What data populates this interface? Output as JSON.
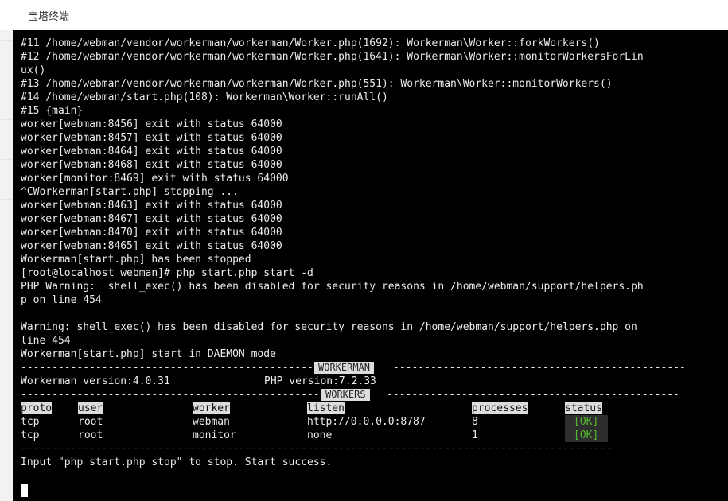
{
  "window": {
    "title": "宝塔终端"
  },
  "colors": {
    "terminal_bg": "#000000",
    "terminal_text": "#ececec",
    "ok_status": "#55b82e",
    "table_header_bg": "#dcdcdc"
  },
  "terminal": {
    "log_lines": [
      "#11 /home/webman/vendor/workerman/workerman/Worker.php(1692): Workerman\\Worker::forkWorkers()",
      "#12 /home/webman/vendor/workerman/workerman/Worker.php(1641): Workerman\\Worker::monitorWorkersForLin",
      "ux()",
      "#13 /home/webman/vendor/workerman/workerman/Worker.php(551): Workerman\\Worker::monitorWorkers()",
      "#14 /home/webman/start.php(108): Workerman\\Worker::runAll()",
      "#15 {main}",
      "worker[webman:8456] exit with status 64000",
      "worker[webman:8457] exit with status 64000",
      "worker[webman:8464] exit with status 64000",
      "worker[webman:8468] exit with status 64000",
      "worker[monitor:8469] exit with status 64000",
      "^CWorkerman[start.php] stopping ...",
      "worker[webman:8463] exit with status 64000",
      "worker[webman:8467] exit with status 64000",
      "worker[webman:8470] exit with status 64000",
      "worker[webman:8465] exit with status 64000",
      "Workerman[start.php] has been stopped",
      "[root@localhost webman]# php start.php start -d",
      "PHP Warning:  shell_exec() has been disabled for security reasons in /home/webman/support/helpers.ph",
      "p on line 454",
      "",
      "Warning: shell_exec() has been disabled for security reasons in /home/webman/support/helpers.php on",
      "line 454",
      "Workerman[start.php] start in DAEMON mode"
    ],
    "workerman_banner": {
      "label": "WORKERMAN",
      "dash_left": "-----------------------------------------------",
      "dash_right": "-----------------------------------------------"
    },
    "versions": {
      "workerman": "Workerman version:4.0.31",
      "php": "PHP version:7.2.33"
    },
    "workers_banner": {
      "label": "WORKERS",
      "dash_left": "------------------------------------------------",
      "dash_right": "-----------------------------------------------"
    },
    "table": {
      "headers": [
        "proto",
        "user",
        "worker",
        "listen",
        "processes",
        "status"
      ],
      "rows": [
        {
          "proto": "tcp",
          "user": "root",
          "worker": "webman",
          "listen": "http://0.0.0.0:8787",
          "processes": "8",
          "status": "[OK]"
        },
        {
          "proto": "tcp",
          "user": "root",
          "worker": "monitor",
          "listen": "none",
          "processes": "1",
          "status": "[OK]"
        }
      ]
    },
    "end_separator": "-----------------------------------------------------------------------------------------------",
    "success_line": "Input \"php start.php stop\" to stop. Start success."
  }
}
